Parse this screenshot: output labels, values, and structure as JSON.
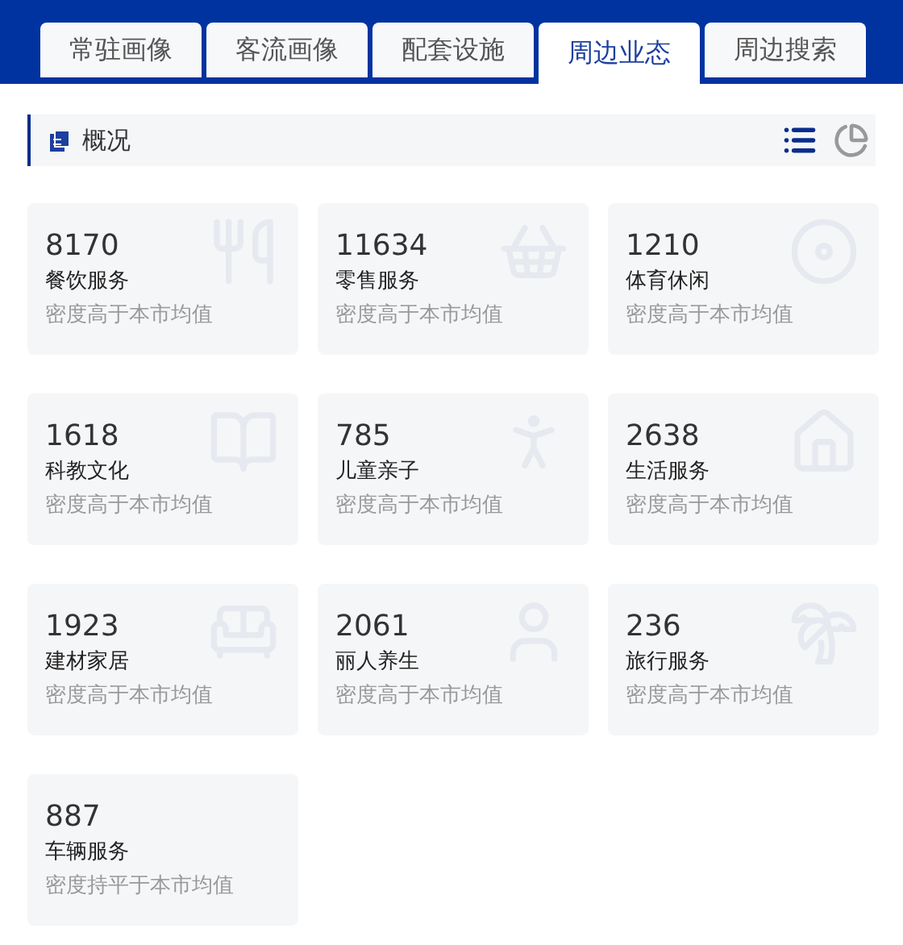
{
  "tabs": [
    {
      "label": "常驻画像",
      "selected": false
    },
    {
      "label": "客流画像",
      "selected": false
    },
    {
      "label": "配套设施",
      "selected": false
    },
    {
      "label": "周边业态",
      "selected": true
    },
    {
      "label": "周边搜索",
      "selected": false
    }
  ],
  "section": {
    "title": "概况",
    "views": [
      {
        "kind": "list",
        "selected": true
      },
      {
        "kind": "pie",
        "selected": false
      }
    ]
  },
  "cards": [
    {
      "count": "8170",
      "category": "餐饮服务",
      "note": "密度高于本市均值"
    },
    {
      "count": "11634",
      "category": "零售服务",
      "note": "密度高于本市均值"
    },
    {
      "count": "1210",
      "category": "体育休闲",
      "note": "密度高于本市均值"
    },
    {
      "count": "1618",
      "category": "科教文化",
      "note": "密度高于本市均值"
    },
    {
      "count": "785",
      "category": "儿童亲子",
      "note": "密度高于本市均值"
    },
    {
      "count": "2638",
      "category": "生活服务",
      "note": "密度高于本市均值"
    },
    {
      "count": "1923",
      "category": "建材家居",
      "note": "密度高于本市均值"
    },
    {
      "count": "2061",
      "category": "丽人养生",
      "note": "密度高于本市均值"
    },
    {
      "count": "236",
      "category": "旅行服务",
      "note": "密度高于本市均值"
    },
    {
      "count": "887",
      "category": "车辆服务",
      "note": "密度持平于本市均值"
    }
  ]
}
